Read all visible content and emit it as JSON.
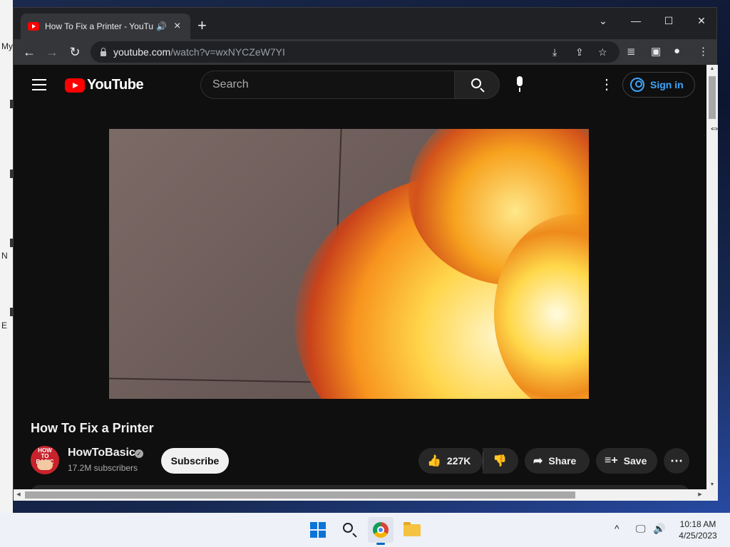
{
  "desktop": {
    "labels": [
      "My",
      "N",
      "E"
    ]
  },
  "browser": {
    "tab": {
      "title": "How To Fix a Printer - YouTube",
      "audio_icon": "speaker-icon",
      "close_icon": "close-icon"
    },
    "new_tab_label": "+",
    "window_controls": {
      "dropdown": "⌄",
      "minimize": "—",
      "maximize": "☐",
      "close": "✕"
    },
    "nav": {
      "back": "←",
      "forward": "→",
      "reload": "↻"
    },
    "address": {
      "domain": "youtube.com",
      "path": "/watch?v=wxNYCZeW7YI"
    },
    "omnibox_icons": [
      "install-icon",
      "share-icon",
      "bookmark-star-icon"
    ],
    "toolbar_icons": [
      "media-control-icon",
      "side-panel-icon",
      "profile-icon",
      "menu-icon"
    ]
  },
  "youtube": {
    "logo_text": "YouTube",
    "search": {
      "placeholder": "Search"
    },
    "sign_in_label": "Sign in",
    "video": {
      "title": "How To Fix a Printer",
      "channel": {
        "name": "HowToBasic",
        "verified": true,
        "subscribers": "17.2M subscribers",
        "avatar_text": "HOW TO BASIC"
      },
      "subscribe_label": "Subscribe",
      "likes": "227K",
      "share_label": "Share",
      "save_label": "Save",
      "more_label": "⋯"
    }
  },
  "taskbar": {
    "apps": [
      "start-icon",
      "search-icon",
      "chrome-icon",
      "file-explorer-icon"
    ],
    "active_app": "chrome-icon",
    "tray": {
      "chevron": "^",
      "time": "10:18 AM",
      "date": "4/25/2023"
    }
  },
  "colors": {
    "youtube_red": "#ff0000",
    "link_blue": "#3ea6ff",
    "page_bg": "#0f0f0f",
    "chrome_toolbar": "#35363a"
  }
}
